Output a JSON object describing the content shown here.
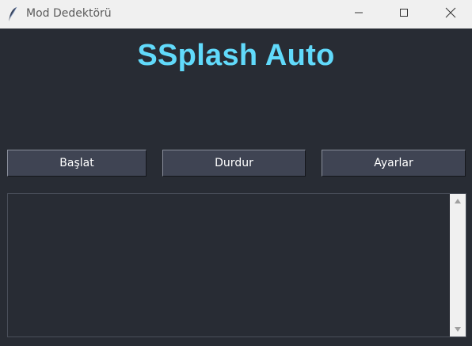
{
  "window": {
    "title": "Mod Dedektörü"
  },
  "main": {
    "heading": "SSplash Auto"
  },
  "buttons": {
    "start_label": "Başlat",
    "stop_label": "Durdur",
    "settings_label": "Ayarlar"
  },
  "log": {
    "content": ""
  },
  "colors": {
    "background": "#282c34",
    "heading": "#61dafb",
    "button_bg": "#3f4453",
    "titlebar": "#f0f0f0"
  },
  "icons": {
    "app": "feather-icon",
    "minimize": "minimize-icon",
    "maximize": "maximize-icon",
    "close": "close-icon",
    "scroll_up": "arrow-up-icon",
    "scroll_down": "arrow-down-icon"
  }
}
